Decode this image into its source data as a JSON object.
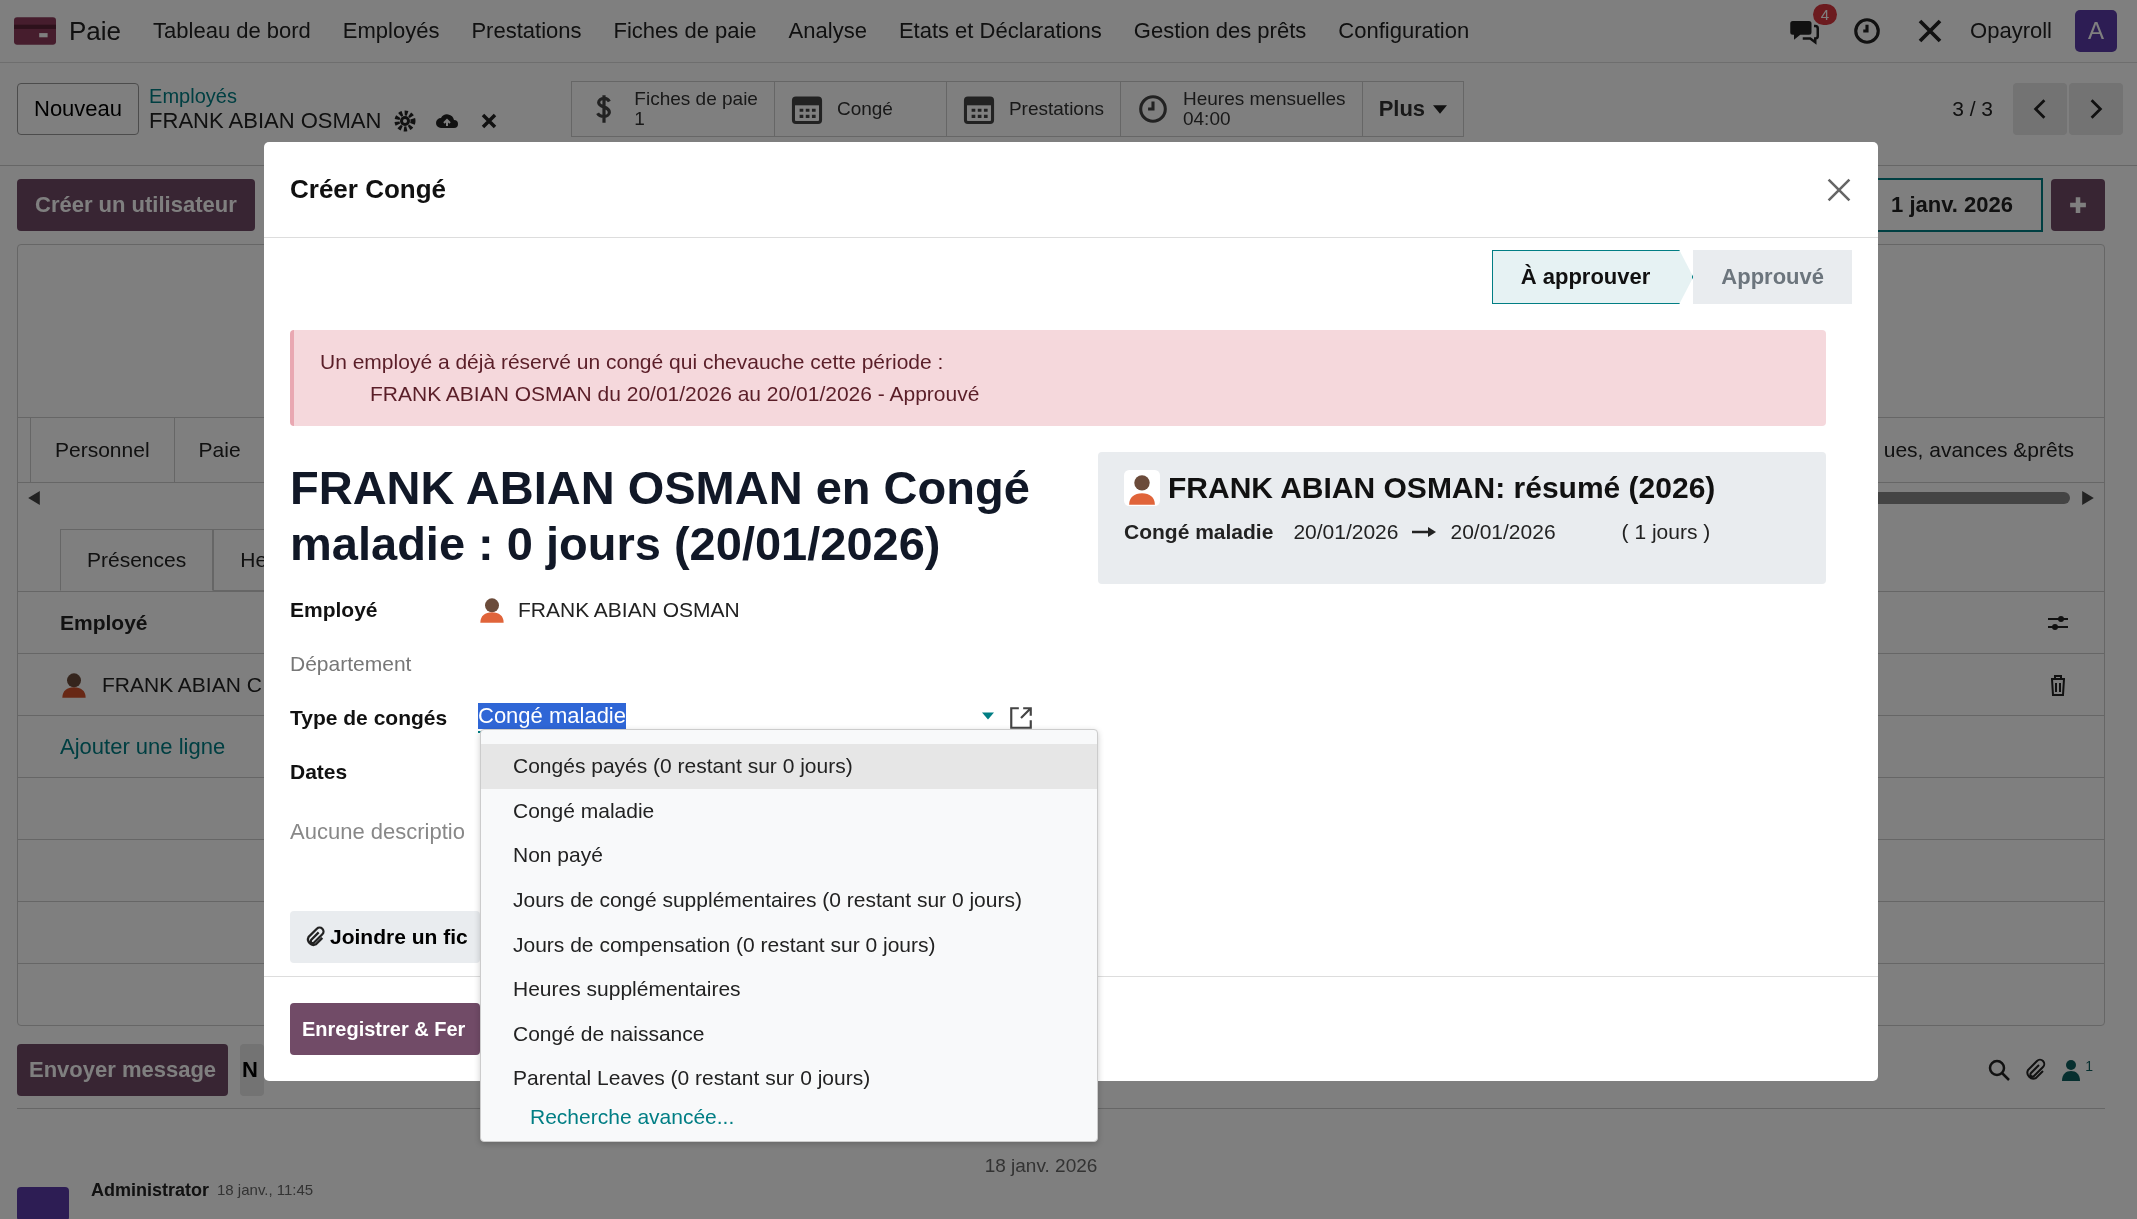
{
  "navbar": {
    "app_name": "Paie",
    "menu": [
      "Tableau de bord",
      "Employés",
      "Prestations",
      "Fiches de paie",
      "Analyse",
      "Etats et Déclarations",
      "Gestion des prêts",
      "Configuration"
    ],
    "notification_count": "4",
    "company": "Opayroll",
    "avatar_letter": "A"
  },
  "control_panel": {
    "new_button": "Nouveau",
    "breadcrumb": {
      "parent": "Employés",
      "current": "FRANK ABIAN OSMAN"
    },
    "smart_buttons": [
      {
        "kind": "payslips",
        "label": "Fiches de paie",
        "value": "1"
      },
      {
        "kind": "calendar",
        "label": "Congé"
      },
      {
        "kind": "calendar",
        "label": "Prestations"
      },
      {
        "kind": "hours",
        "label": "Heures mensuelles",
        "value": "04:00"
      },
      {
        "kind": "more",
        "label": "Plus"
      }
    ],
    "pager": "3 / 3"
  },
  "form": {
    "create_user_button": "Créer un utilisateur",
    "date_field": "1 janv. 2026",
    "tabs": [
      "Personnel",
      "Paie",
      "ues, avances &prêts"
    ],
    "sub_tabs": [
      {
        "label": "Présences",
        "selected": true
      },
      {
        "label": "He",
        "selected": false
      }
    ],
    "table": {
      "column": "Employé",
      "rows": [
        "FRANK ABIAN C"
      ],
      "add_line": "Ajouter une ligne"
    }
  },
  "chatter": {
    "send_message": "Envoyer message",
    "note_button": "N",
    "follower_count": "1",
    "date_separator": "18 janv. 2026",
    "messages": [
      {
        "author": "Administrator",
        "time": "18 janv., 11:45"
      }
    ]
  },
  "dialog": {
    "title": "Créer Congé",
    "status_steps": [
      {
        "label": "À approuver",
        "selected": true
      },
      {
        "label": "Approuvé",
        "selected": false
      }
    ],
    "alert": {
      "message": "Un employé a déjà réservé un congé qui chevauche cette période :",
      "details": [
        "FRANK ABIAN OSMAN du 20/01/2026 au 20/01/2026 - Approuvé"
      ]
    },
    "heading": "FRANK ABIAN OSMAN en Congé maladie : 0 jours (20/01/2026)",
    "fields": [
      {
        "kind": "employee",
        "label": "Employé",
        "value": "FRANK ABIAN OSMAN"
      },
      {
        "kind": "readonly",
        "label": "Département"
      },
      {
        "kind": "select",
        "label": "Type de congés",
        "value": "Congé maladie"
      },
      {
        "kind": "empty",
        "label": "Dates"
      }
    ],
    "description_placeholder": "Aucune descriptio",
    "attach_button": "Joindre un fic",
    "summary": {
      "title": "FRANK ABIAN OSMAN: résumé (2026)",
      "rows": [
        {
          "type": "Congé maladie",
          "from": "20/01/2026",
          "to": "20/01/2026",
          "duration": "( 1 jours )"
        }
      ]
    },
    "footer_buttons": [
      "Enregistrer & Fer"
    ],
    "dropdown": {
      "options": [
        {
          "label": "Congés payés (0 restant sur 0 jours)",
          "selected": true
        },
        {
          "label": "Congé maladie",
          "selected": false
        },
        {
          "label": "Non payé",
          "selected": false
        },
        {
          "label": "Jours de congé supplémentaires (0 restant sur 0 jours)",
          "selected": false
        },
        {
          "label": "Jours de compensation (0 restant sur 0 jours)",
          "selected": false
        },
        {
          "label": "Heures supplémentaires",
          "selected": false
        },
        {
          "label": "Congé de naissance",
          "selected": false
        },
        {
          "label": "Parental Leaves (0 restant sur 0 jours)",
          "selected": false
        }
      ],
      "more_link": "Recherche avancée..."
    }
  }
}
